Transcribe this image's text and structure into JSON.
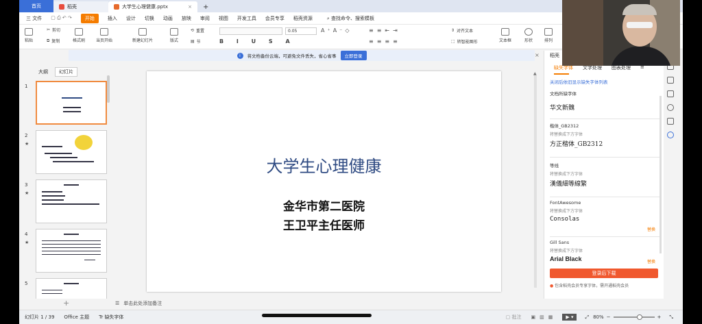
{
  "tabs": {
    "home": "首页",
    "docer": "稻壳",
    "document": "大学生心理健康.pptx"
  },
  "menu": {
    "file": "三 文件",
    "start": "开始",
    "insert": "插入",
    "design": "设计",
    "transition": "切换",
    "animation": "动画",
    "slideshow": "放映",
    "review": "审阅",
    "view": "视图",
    "devtools": "开发工具",
    "member": "会员专享",
    "docer_res": "稻壳资源",
    "search": "查找命令、搜索模板"
  },
  "toolbar": {
    "paste": "粘贴",
    "cut": "剪切",
    "copy": "复制",
    "format_painter": "格式刷",
    "from_current": "当页开始",
    "new_slide": "新建幻灯片",
    "layout": "版式",
    "section": "节",
    "redo_title": "重置",
    "font_size": "0.05",
    "align": "对齐文本",
    "smartart": "转智能图形",
    "textbox": "文本框",
    "shape": "形状",
    "arrange": "排列"
  },
  "notice": {
    "text": "将文档备份云端，可避免文件丢失，省心省事",
    "button": "立即登录"
  },
  "left_pane": {
    "tab_outline": "大纲",
    "tab_slides": "幻灯片",
    "slides": [
      "1",
      "2",
      "3",
      "4",
      "5"
    ]
  },
  "slide": {
    "title": "大学生心理健康",
    "line1": "金华市第二医院",
    "line2": "王卫平主任医师"
  },
  "notes": {
    "placeholder": "单击此处添加备注"
  },
  "right_panel": {
    "header": "稻壳",
    "tabs": [
      "缺失字体",
      "文字处理",
      "图表处理"
    ],
    "link": "关闭后依旧显示缺失字体列表",
    "section_label": "文档所缺字体",
    "fonts": [
      {
        "name": "",
        "hint": "",
        "replacement": "华文新魏",
        "action": ""
      },
      {
        "name": "楷体_GB2312",
        "hint": "将替换成下方字体",
        "replacement": "方正楷体_GB2312",
        "action": ""
      },
      {
        "name": "等线",
        "hint": "将替换成下方字体",
        "replacement": "漢儀細等線繁",
        "action": ""
      },
      {
        "name": "FontAwesome",
        "hint": "将替换成下方字体",
        "replacement": "Consolas",
        "action": "替换"
      },
      {
        "name": "Gill Sans",
        "hint": "将替换成下方字体",
        "replacement": "Arial Black",
        "action": "替换"
      }
    ],
    "download_button": "登录后下载",
    "tip": "包含稻壳会员专享字体，需开通稻壳会员"
  },
  "status": {
    "slide_count": "幻灯片 1 / 39",
    "theme": "Office 主题",
    "missing_font": "缺失字体",
    "annotate": "批注",
    "zoom": "80%"
  },
  "colors": {
    "accent": "#f57c00",
    "blue": "#3a6fd8",
    "title_blue": "#2e4a82"
  }
}
